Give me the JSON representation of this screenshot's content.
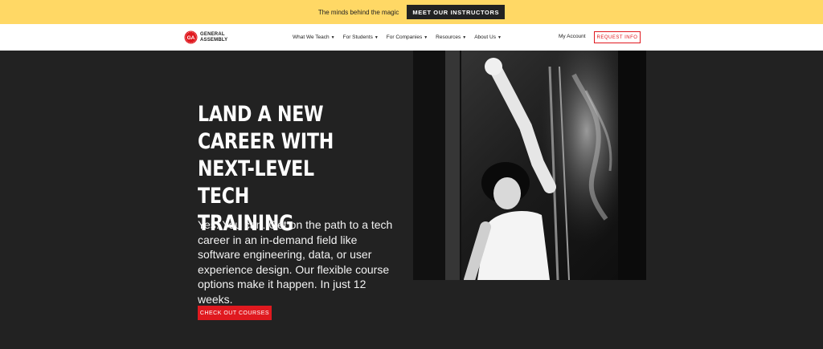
{
  "promo": {
    "text": "The minds behind the magic",
    "button_label": "MEET OUR INSTRUCTORS"
  },
  "nav": {
    "logo_line1": "GENERAL",
    "logo_line2": "ASSEMBLY",
    "logo_mark": "GA",
    "items": [
      {
        "label": "What We Teach"
      },
      {
        "label": "For Students"
      },
      {
        "label": "For Companies"
      },
      {
        "label": "Resources"
      },
      {
        "label": "About Us"
      }
    ],
    "account_label": "My Account",
    "request_label": "REQUEST INFO"
  },
  "hero": {
    "title_lines": [
      "LAND A NEW",
      "CAREER WITH",
      "NEXT-LEVEL TECH",
      "TRAINING"
    ],
    "body": "Yes. You can. Get on the path to a tech career in an in-demand field like software engineering, data, or user experience design. Our flexible course options make it happen. In just 12 weeks.",
    "cta_label": "CHECK OUT COURSES"
  },
  "colors": {
    "promo_bg": "#FFD865",
    "hero_bg": "#222222",
    "accent_red": "#E0191F",
    "white": "#FFFFFF"
  },
  "icons": {
    "caret": "chevron-down-icon",
    "logo": "ga-logo-icon"
  }
}
